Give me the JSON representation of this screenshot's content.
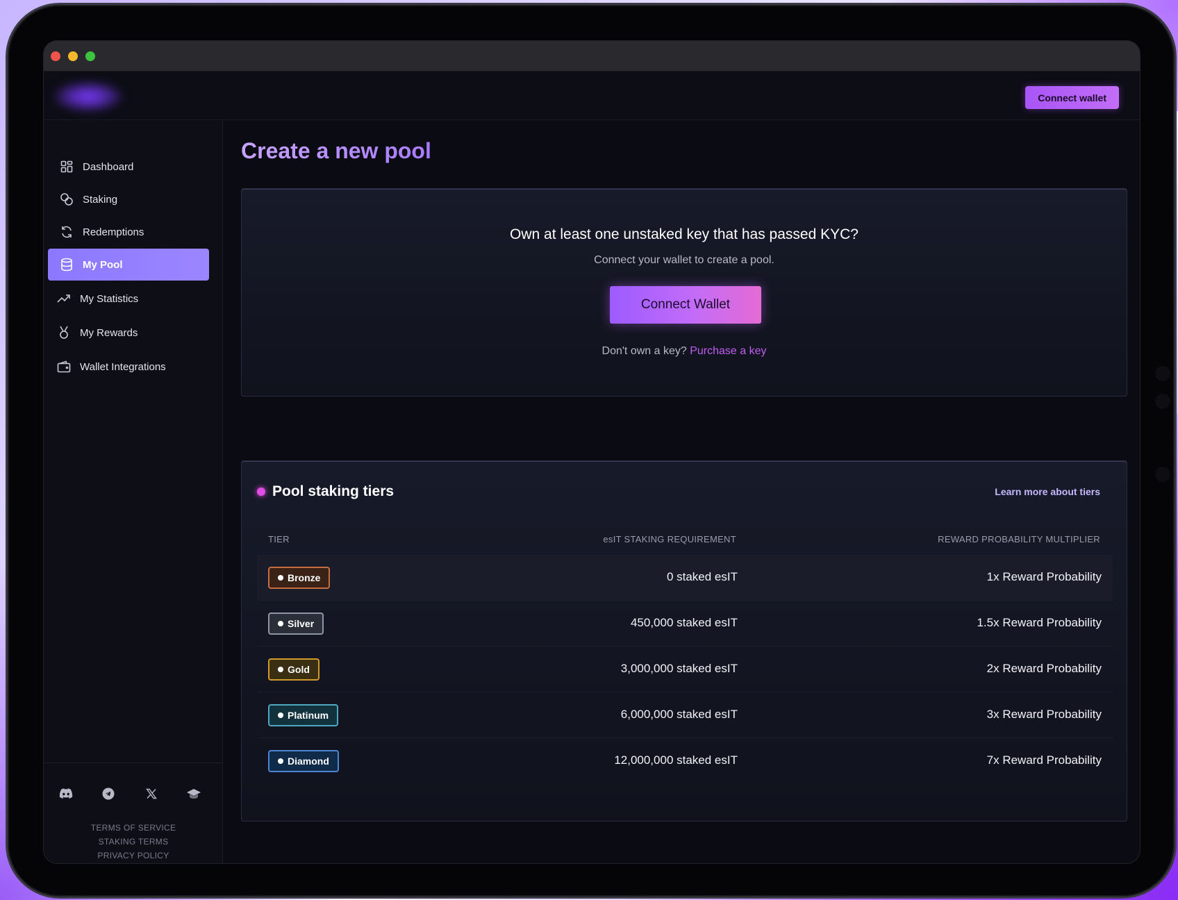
{
  "window": {
    "title": ""
  },
  "header": {
    "connect_label": "Connect wallet"
  },
  "sidebar": {
    "items": [
      {
        "label": "Dashboard",
        "icon": "grid-icon",
        "active": false
      },
      {
        "label": "Staking",
        "icon": "coins-icon",
        "active": false
      },
      {
        "label": "Redemptions",
        "icon": "refresh-icon",
        "active": false
      },
      {
        "label": "My Pool",
        "icon": "database-icon",
        "active": true
      },
      {
        "label": "My Statistics",
        "icon": "trend-up-icon",
        "active": false
      },
      {
        "label": "My Rewards",
        "icon": "medal-icon",
        "active": false
      },
      {
        "label": "Wallet Integrations",
        "icon": "wallet-icon",
        "active": false
      }
    ],
    "social": [
      "discord-icon",
      "telegram-icon",
      "x-icon",
      "graduation-cap-icon"
    ],
    "legal": [
      "TERMS OF SERVICE",
      "STAKING TERMS",
      "PRIVACY POLICY"
    ]
  },
  "main": {
    "title": "Create a new pool",
    "kyc": {
      "question": "Own at least one unstaked key that has passed KYC?",
      "subtitle": "Connect your wallet to create a pool.",
      "button": "Connect Wallet",
      "footer_text": "Don't own a key?",
      "footer_link": "Purchase a key"
    },
    "tiers": {
      "title": "Pool staking tiers",
      "learn_more": "Learn more about tiers",
      "columns": [
        "TIER",
        "esIT STAKING REQUIREMENT",
        "REWARD PROBABILITY MULTIPLIER"
      ],
      "rows": [
        {
          "tier": "Bronze",
          "requirement": "0 staked esIT",
          "multiplier": "1x Reward Probability"
        },
        {
          "tier": "Silver",
          "requirement": "450,000 staked esIT",
          "multiplier": "1.5x Reward Probability"
        },
        {
          "tier": "Gold",
          "requirement": "3,000,000 staked esIT",
          "multiplier": "2x Reward Probability"
        },
        {
          "tier": "Platinum",
          "requirement": "6,000,000 staked esIT",
          "multiplier": "3x Reward Probability"
        },
        {
          "tier": "Diamond",
          "requirement": "12,000,000 staked esIT",
          "multiplier": "7x Reward Probability"
        }
      ]
    }
  },
  "colors": {
    "accent": "#a855f7",
    "active_nav": "#8b78ff",
    "link": "#c05ef2",
    "bronze": "#c66f3e",
    "silver": "#8f97a6",
    "gold": "#d19a2a",
    "platinum": "#4fa8c0",
    "diamond": "#4a86d4"
  }
}
